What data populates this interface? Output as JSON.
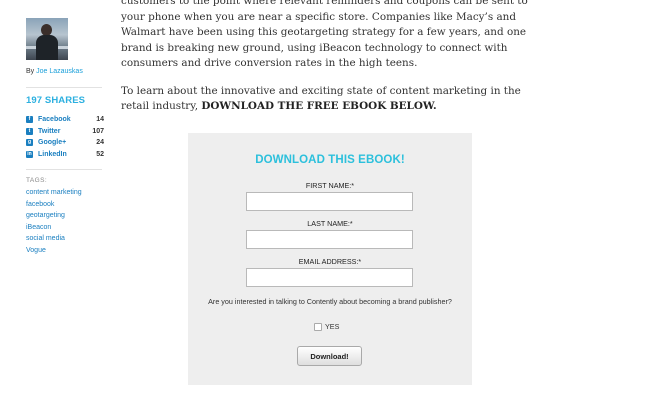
{
  "author": {
    "by_label": "By",
    "name": "Joe Lazauskas"
  },
  "shares": {
    "title": "197 SHARES",
    "items": [
      {
        "network": "Facebook",
        "count": "14",
        "icon": "facebook-icon"
      },
      {
        "network": "Twitter",
        "count": "107",
        "icon": "twitter-icon"
      },
      {
        "network": "Google+",
        "count": "24",
        "icon": "google-plus-icon"
      },
      {
        "network": "LinkedIn",
        "count": "52",
        "icon": "linkedin-icon"
      }
    ]
  },
  "tags": {
    "title": "TAGS:",
    "items": [
      "content marketing",
      "facebook",
      "geotargeting",
      "iBeacon",
      "social media",
      "Vogue"
    ]
  },
  "article": {
    "paragraph1": "customers to the point where relevant reminders and coupons can be sent to your phone when you are near a specific store. Companies like Macy’s and Walmart have been using this geotargeting strategy for a few years, and one brand is breaking new ground, using iBeacon technology to connect with consumers and drive conversion rates in the high teens.",
    "paragraph2_text": "To learn about the innovative and exciting state of content marketing in the retail industry, ",
    "paragraph2_cta": "DOWNLOAD THE FREE EBOOK BELOW."
  },
  "form": {
    "title": "DOWNLOAD THIS EBOOK!",
    "first_name_label": "FIRST NAME:*",
    "first_name_value": "",
    "last_name_label": "LAST NAME:*",
    "last_name_value": "",
    "email_label": "EMAIL ADDRESS:*",
    "email_value": "",
    "question": "Are you interested in talking to Contently about becoming a brand publisher?",
    "yes_label": "YES",
    "submit_label": "Download!"
  },
  "colors": {
    "accent": "#2cc0dc",
    "link": "#1a7fc0",
    "form_bg": "#eeeeee"
  }
}
